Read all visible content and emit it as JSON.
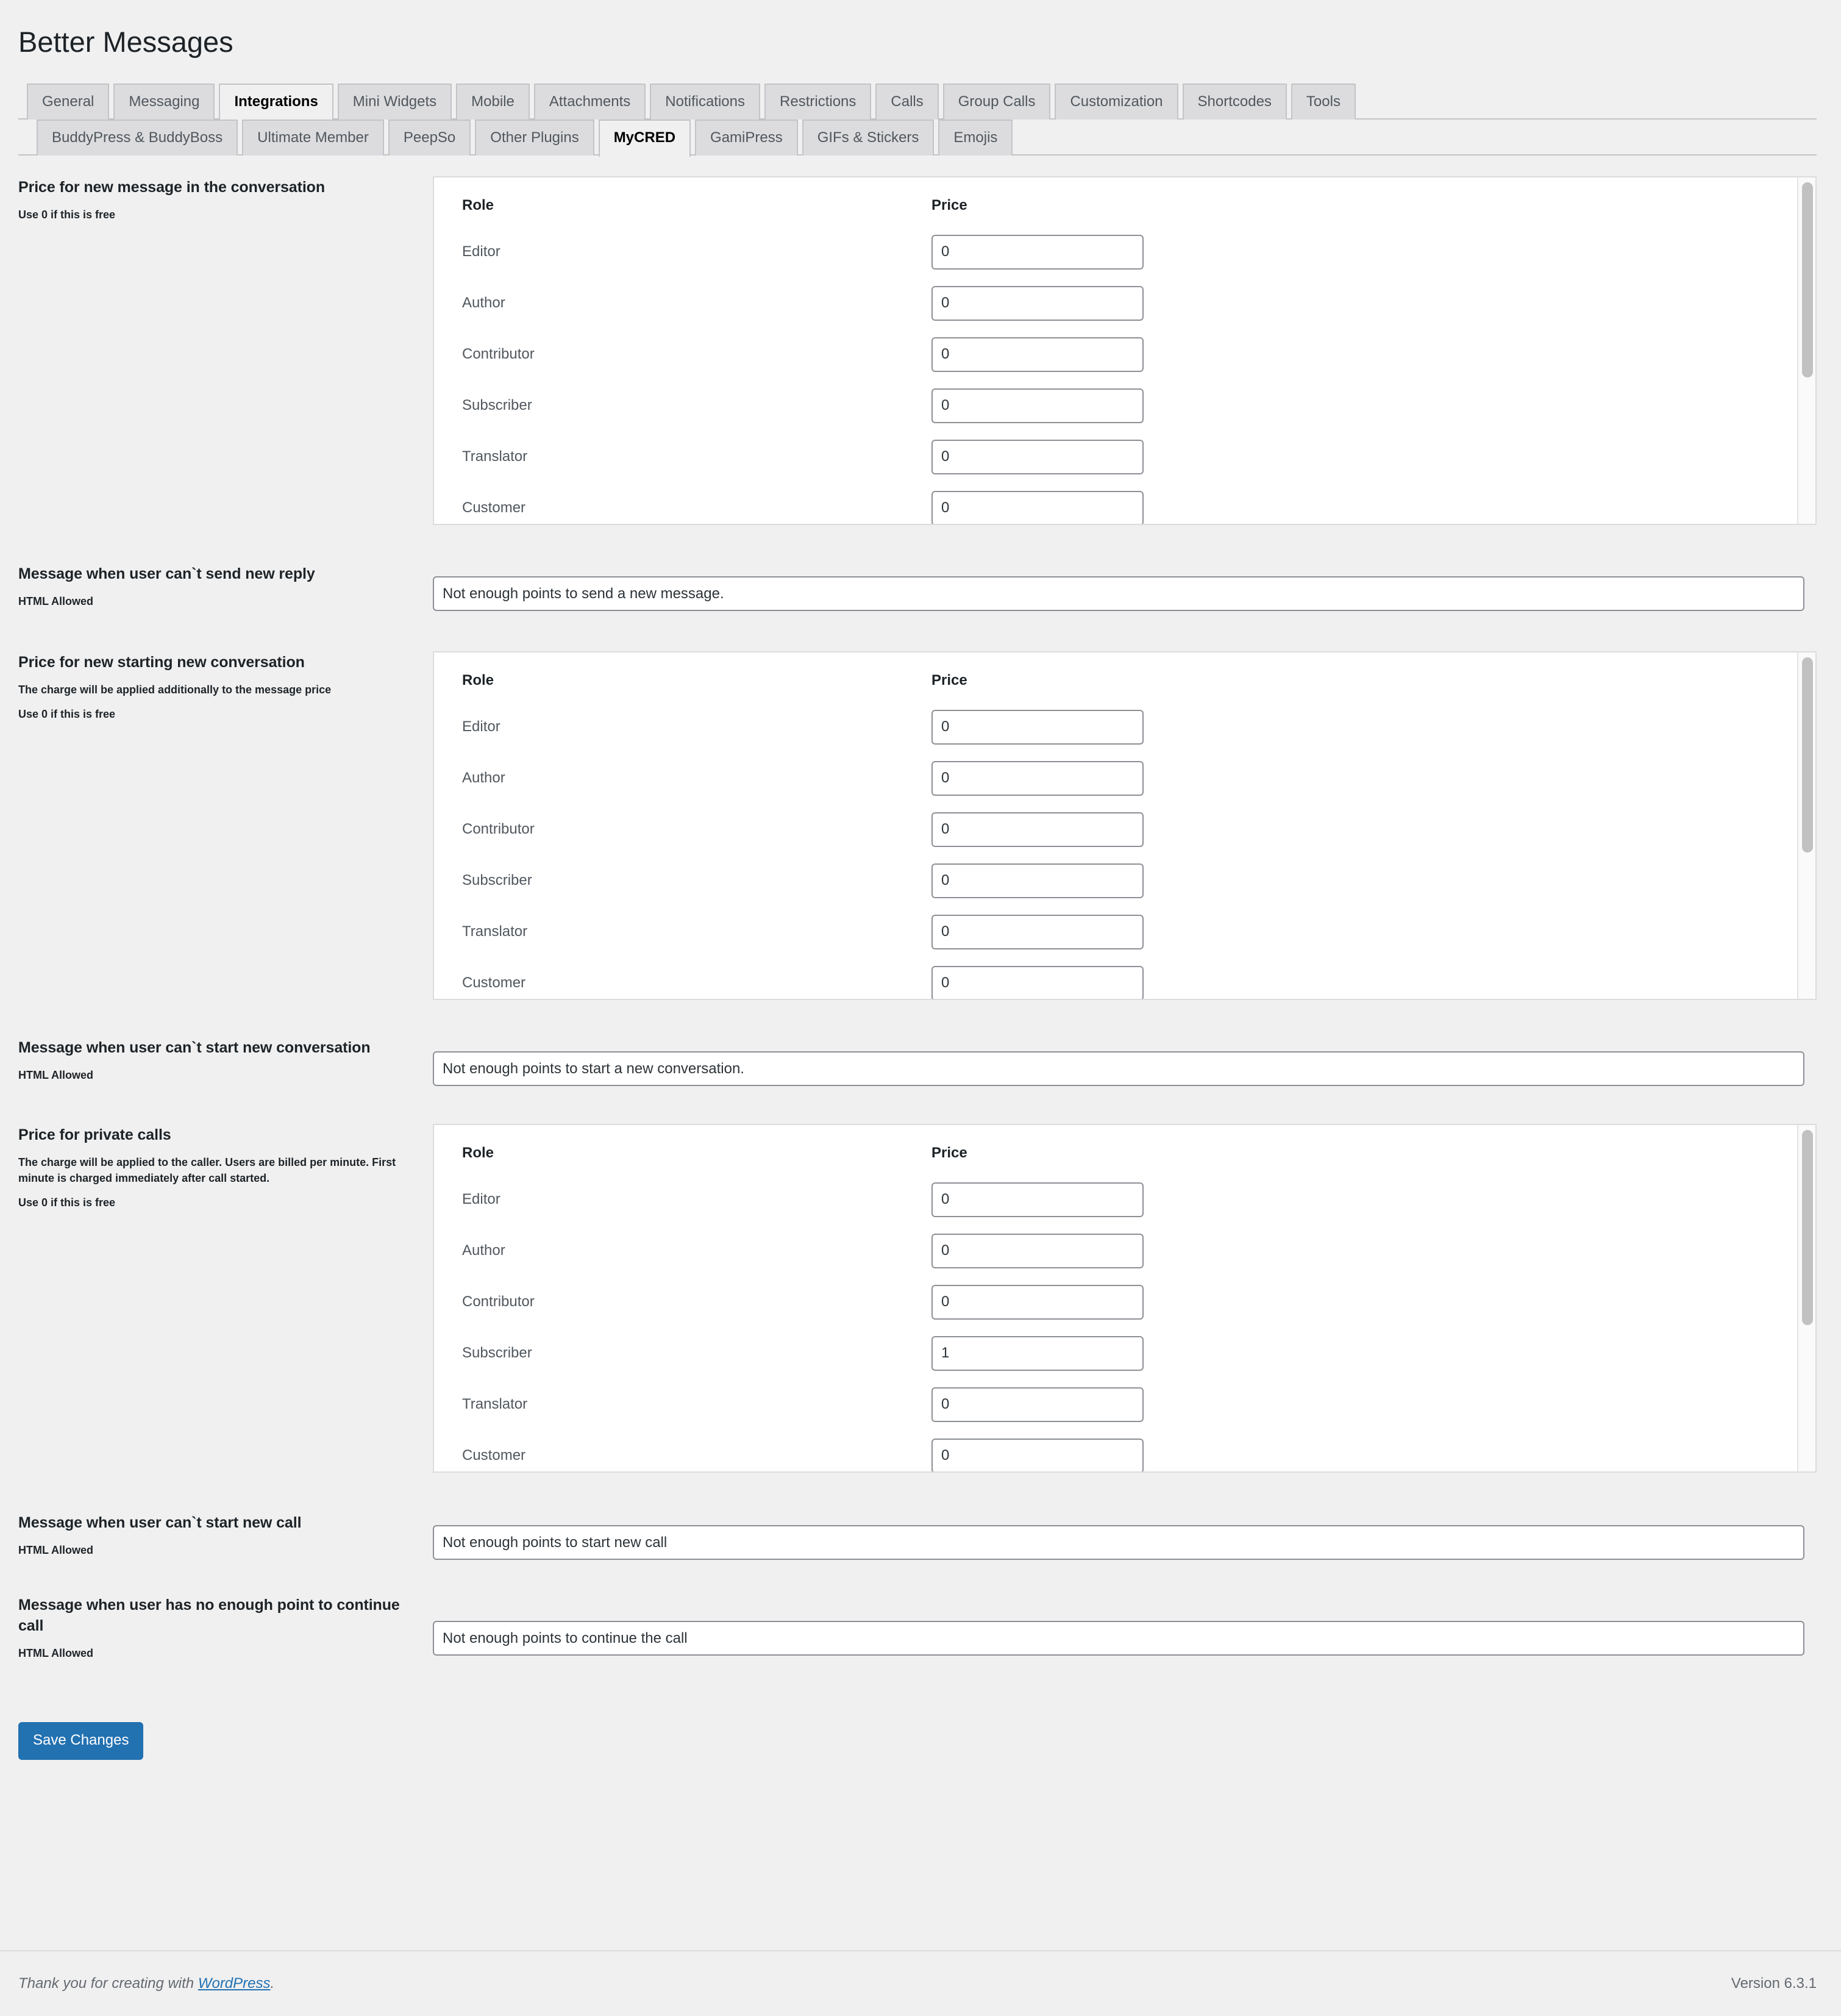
{
  "header": {
    "title": "Better Messages"
  },
  "tabs_primary": [
    {
      "label": "General",
      "active": false
    },
    {
      "label": "Messaging",
      "active": false
    },
    {
      "label": "Integrations",
      "active": true
    },
    {
      "label": "Mini Widgets",
      "active": false
    },
    {
      "label": "Mobile",
      "active": false
    },
    {
      "label": "Attachments",
      "active": false
    },
    {
      "label": "Notifications",
      "active": false
    },
    {
      "label": "Restrictions",
      "active": false
    },
    {
      "label": "Calls",
      "active": false
    },
    {
      "label": "Group Calls",
      "active": false
    },
    {
      "label": "Customization",
      "active": false
    },
    {
      "label": "Shortcodes",
      "active": false
    },
    {
      "label": "Tools",
      "active": false
    }
  ],
  "tabs_secondary": [
    {
      "label": "BuddyPress & BuddyBoss",
      "active": false
    },
    {
      "label": "Ultimate Member",
      "active": false
    },
    {
      "label": "PeepSo",
      "active": false
    },
    {
      "label": "Other Plugins",
      "active": false
    },
    {
      "label": "MyCRED",
      "active": true
    },
    {
      "label": "GamiPress",
      "active": false
    },
    {
      "label": "GIFs & Stickers",
      "active": false
    },
    {
      "label": "Emojis",
      "active": false
    }
  ],
  "table_headers": {
    "role": "Role",
    "price": "Price"
  },
  "sections": {
    "message_price": {
      "title": "Price for new message in the conversation",
      "desc1": "Use 0 if this is free",
      "rows": [
        {
          "role": "Editor",
          "price": "0"
        },
        {
          "role": "Author",
          "price": "0"
        },
        {
          "role": "Contributor",
          "price": "0"
        },
        {
          "role": "Subscriber",
          "price": "0"
        },
        {
          "role": "Translator",
          "price": "0"
        },
        {
          "role": "Customer",
          "price": "0"
        }
      ]
    },
    "cant_send_reply": {
      "title": "Message when user can`t send new reply",
      "desc1": "HTML Allowed",
      "value": "Not enough points to send a new message."
    },
    "conversation_price": {
      "title": "Price for new starting new conversation",
      "desc1": "The charge will be applied additionally to the message price",
      "desc2": "Use 0 if this is free",
      "rows": [
        {
          "role": "Editor",
          "price": "0"
        },
        {
          "role": "Author",
          "price": "0"
        },
        {
          "role": "Contributor",
          "price": "0"
        },
        {
          "role": "Subscriber",
          "price": "0"
        },
        {
          "role": "Translator",
          "price": "0"
        },
        {
          "role": "Customer",
          "price": "0"
        }
      ]
    },
    "cant_start_conversation": {
      "title": "Message when user can`t start new conversation",
      "desc1": "HTML Allowed",
      "value": "Not enough points to start a new conversation."
    },
    "calls_price": {
      "title": "Price for private calls",
      "desc1": "The charge will be applied to the caller. Users are billed per minute. First minute is charged immediately after call started.",
      "desc2": "Use 0 if this is free",
      "rows": [
        {
          "role": "Editor",
          "price": "0"
        },
        {
          "role": "Author",
          "price": "0"
        },
        {
          "role": "Contributor",
          "price": "0"
        },
        {
          "role": "Subscriber",
          "price": "1"
        },
        {
          "role": "Translator",
          "price": "0"
        },
        {
          "role": "Customer",
          "price": "0"
        }
      ]
    },
    "cant_start_call": {
      "title": "Message when user can`t start new call",
      "desc1": "HTML Allowed",
      "value": "Not enough points to start new call"
    },
    "cant_continue_call": {
      "title": "Message when user has no enough point to continue call",
      "desc1": "HTML Allowed",
      "value": "Not enough points to continue the call"
    }
  },
  "save": {
    "label": "Save Changes"
  },
  "footer": {
    "thanks_prefix": "Thank you for creating with ",
    "wordpress_link": "WordPress",
    "thanks_suffix": ".",
    "version": "Version 6.3.1"
  },
  "colors": {
    "accent": "#2271b1",
    "page_bg": "#f0f0f1",
    "tab_inactive_bg": "#dcdcde",
    "border": "#c3c4c7",
    "input_border": "#8c8f94",
    "scroll_thumb": "#c1c1c1"
  }
}
